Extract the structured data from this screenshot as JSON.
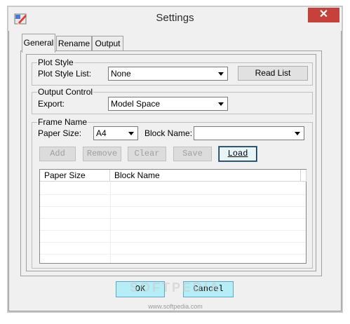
{
  "window": {
    "title": "Settings",
    "close_glyph": "✕",
    "app_icon": "app-pencil-icon"
  },
  "tabs": [
    {
      "label": "General",
      "active": true
    },
    {
      "label": "Rename",
      "active": false
    },
    {
      "label": "Output",
      "active": false
    }
  ],
  "plot_style": {
    "legend": "Plot Style",
    "list_label": "Plot Style List:",
    "list_value": "None",
    "read_list_label": "Read List"
  },
  "output_control": {
    "legend": "Output Control",
    "export_label": "Export:",
    "export_value": "Model Space"
  },
  "frame_name": {
    "legend": "Frame Name",
    "paper_size_label": "Paper Size:",
    "paper_size_value": "A4",
    "block_name_label": "Block Name:",
    "block_name_value": "",
    "buttons": {
      "add": "Add",
      "remove": "Remove",
      "clear": "Clear",
      "save": "Save",
      "load": "Load"
    },
    "table": {
      "columns": [
        "Paper Size",
        "Block Name"
      ],
      "rows": []
    }
  },
  "footer": {
    "ok_label": "OK",
    "cancel_label": "Cancel"
  },
  "watermark": {
    "text": "SOFTPEDIA",
    "url": "www.softpedia.com"
  },
  "colors": {
    "close_red": "#c7403a",
    "button_cyan": "#b6eef8",
    "focus_border": "#3c7fb1"
  }
}
